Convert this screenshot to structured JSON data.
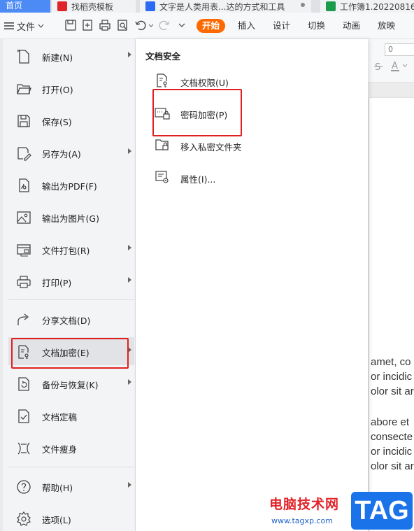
{
  "tabs": [
    {
      "label": "首页"
    },
    {
      "label": "找稻壳模板"
    },
    {
      "label": "文字是人类用表...达的方式和工具"
    },
    {
      "label": "工作簿1.20220816"
    }
  ],
  "toolbar": {
    "file_label": "文件",
    "ribbon_tabs": [
      "开始",
      "插入",
      "设计",
      "切换",
      "动画",
      "放映"
    ]
  },
  "sub_ribbon": {
    "size_value": "0"
  },
  "file_menu": {
    "items": [
      {
        "label": "新建(N)",
        "icon": "new-file-icon",
        "submenu": true
      },
      {
        "label": "打开(O)",
        "icon": "folder-open-icon",
        "submenu": false
      },
      {
        "label": "保存(S)",
        "icon": "save-icon",
        "submenu": false
      },
      {
        "label": "另存为(A)",
        "icon": "save-as-icon",
        "submenu": true
      },
      {
        "label": "输出为PDF(F)",
        "icon": "pdf-icon",
        "submenu": false
      },
      {
        "label": "输出为图片(G)",
        "icon": "image-icon",
        "submenu": false
      },
      {
        "label": "文件打包(R)",
        "icon": "package-icon",
        "submenu": true
      },
      {
        "label": "打印(P)",
        "icon": "print-icon",
        "submenu": true
      },
      {
        "label": "分享文档(D)",
        "icon": "share-icon",
        "submenu": false
      },
      {
        "label": "文档加密(E)",
        "icon": "encrypt-doc-icon",
        "submenu": true,
        "selected": true
      },
      {
        "label": "备份与恢复(K)",
        "icon": "backup-icon",
        "submenu": true
      },
      {
        "label": "文档定稿",
        "icon": "finalize-icon",
        "submenu": false
      },
      {
        "label": "文件瘦身",
        "icon": "slim-icon",
        "submenu": false
      },
      {
        "label": "帮助(H)",
        "icon": "help-icon",
        "submenu": true
      },
      {
        "label": "选项(L)",
        "icon": "settings-icon",
        "submenu": false
      }
    ]
  },
  "submenu": {
    "title": "文档安全",
    "items": [
      {
        "label": "文档权限(U)",
        "icon": "doc-permission-icon"
      },
      {
        "label": "密码加密(P)",
        "icon": "password-lock-icon",
        "highlighted": true
      },
      {
        "label": "移入私密文件夹",
        "icon": "private-folder-icon"
      },
      {
        "label": "属性(I)...",
        "icon": "properties-icon"
      }
    ]
  },
  "document_text": [
    "amet, co",
    "or incidic",
    "olor sit ar",
    "abore et",
    "consecte",
    "or incidic",
    "olor sit ar"
  ],
  "watermark": {
    "text": "电脑技术网",
    "url": "www.tagxp.com",
    "badge": "TAG"
  },
  "colors": {
    "accent": "#ff6a00",
    "highlight": "#e02020",
    "brand_blue": "#1a73e8"
  }
}
